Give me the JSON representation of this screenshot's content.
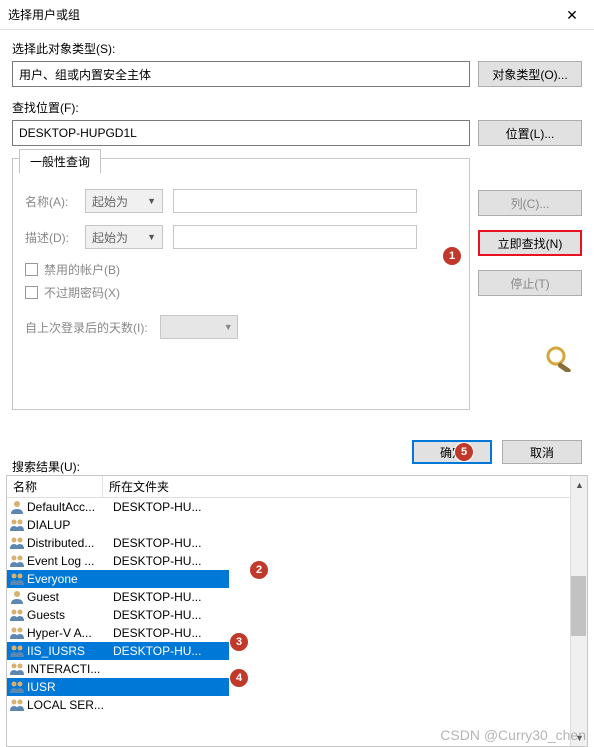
{
  "window": {
    "title": "选择用户或组",
    "close_glyph": "✕"
  },
  "object_type": {
    "label": "选择此对象类型(S):",
    "value": "用户、组或内置安全主体",
    "button": "对象类型(O)..."
  },
  "location": {
    "label": "查找位置(F):",
    "value": "DESKTOP-HUPGD1L",
    "button": "位置(L)..."
  },
  "queries": {
    "tab_label": "一般性查询",
    "name_label": "名称(A):",
    "name_op": "起始为",
    "desc_label": "描述(D):",
    "desc_op": "起始为",
    "chk_disabled": "禁用的帐户(B)",
    "chk_noexpire": "不过期密码(X)",
    "days_label": "自上次登录后的天数(I):"
  },
  "side_buttons": {
    "columns": "列(C)...",
    "find_now": "立即查找(N)",
    "stop": "停止(T)"
  },
  "dialog_buttons": {
    "ok": "确定",
    "cancel": "取消"
  },
  "results": {
    "label": "搜索结果(U):",
    "col_name": "名称",
    "col_folder": "所在文件夹",
    "rows": [
      {
        "name": "DefaultAcc...",
        "folder": "DESKTOP-HU...",
        "sel": false,
        "type": "user"
      },
      {
        "name": "DIALUP",
        "folder": "",
        "sel": false,
        "type": "group"
      },
      {
        "name": "Distributed...",
        "folder": "DESKTOP-HU...",
        "sel": false,
        "type": "group"
      },
      {
        "name": "Event Log ...",
        "folder": "DESKTOP-HU...",
        "sel": false,
        "type": "group"
      },
      {
        "name": "Everyone",
        "folder": "",
        "sel": true,
        "type": "group"
      },
      {
        "name": "Guest",
        "folder": "DESKTOP-HU...",
        "sel": false,
        "type": "user"
      },
      {
        "name": "Guests",
        "folder": "DESKTOP-HU...",
        "sel": false,
        "type": "group"
      },
      {
        "name": "Hyper-V A...",
        "folder": "DESKTOP-HU...",
        "sel": false,
        "type": "group"
      },
      {
        "name": "IIS_IUSRS",
        "folder": "DESKTOP-HU...",
        "sel": true,
        "type": "group"
      },
      {
        "name": "INTERACTI...",
        "folder": "",
        "sel": false,
        "type": "group"
      },
      {
        "name": "IUSR",
        "folder": "",
        "sel": true,
        "type": "group"
      },
      {
        "name": "LOCAL SER...",
        "folder": "",
        "sel": false,
        "type": "group"
      }
    ]
  },
  "markers": {
    "m1": "1",
    "m2": "2",
    "m3": "3",
    "m4": "4",
    "m5": "5"
  },
  "watermark": "CSDN @Curry30_chen"
}
